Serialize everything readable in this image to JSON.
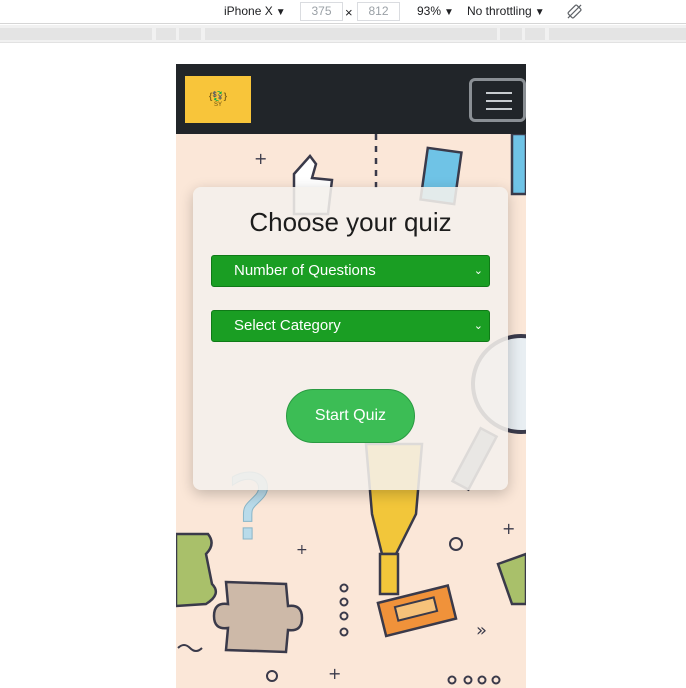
{
  "devtools": {
    "device": "iPhone X",
    "width": "375",
    "height": "812",
    "zoom": "93%",
    "throttling": "No throttling",
    "dim_separator": "×"
  },
  "app": {
    "logo_mark": "{💱}",
    "logo_text": "SY",
    "nav_toggle": "menu-icon"
  },
  "quiz": {
    "title": "Choose your quiz",
    "questions_select": "Number of Questions",
    "category_select": "Select Category",
    "start_label": "Start Quiz"
  },
  "colors": {
    "navbar": "#212529",
    "logo": "#f8c53a",
    "select": "#1a9e23",
    "start_button": "#3cbd55",
    "background": "#fbe7d8"
  }
}
